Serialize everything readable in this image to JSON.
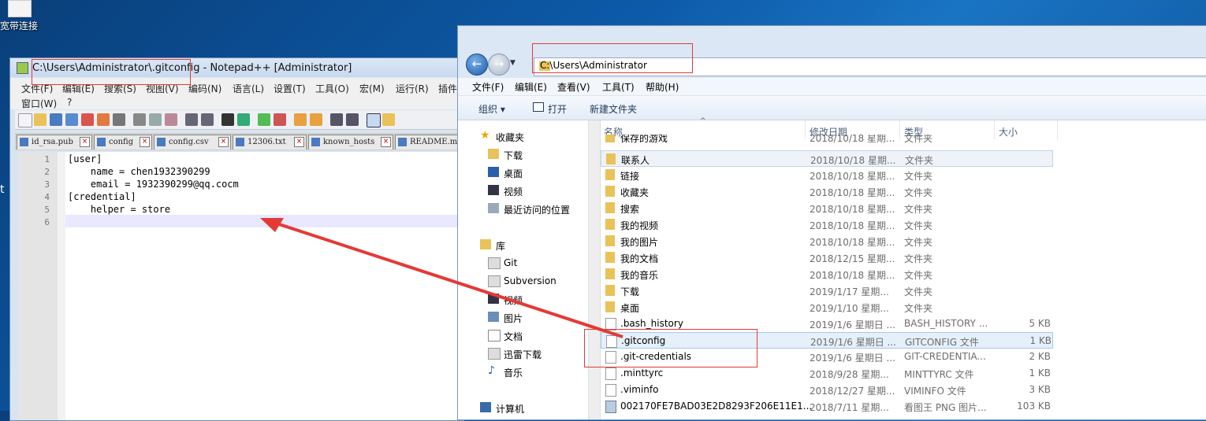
{
  "desktop": {
    "icon_label": "宽带连接",
    "fragment": "t"
  },
  "notepad": {
    "title": "C:\\Users\\Administrator\\.gitconfig - Notepad++ [Administrator]",
    "menu": [
      "文件(F)",
      "编辑(E)",
      "搜索(S)",
      "视图(V)",
      "编码(N)",
      "语言(L)",
      "设置(T)",
      "工具(O)",
      "宏(M)",
      "运行(R)",
      "插件",
      "窗口(W)",
      "?"
    ],
    "tabs": [
      "id_rsa.pub",
      "config",
      "config.csv",
      "12306.txt",
      "known_hosts",
      "README.md"
    ],
    "lines": [
      "1",
      "2",
      "3",
      "4",
      "5",
      "6"
    ],
    "code": [
      "[user]",
      "    name = chen1932390299",
      "    email = 1932390299@qq.cocm",
      "[credential]",
      "    helper = store",
      ""
    ]
  },
  "explorer": {
    "address": "C:\\Users\\Administrator",
    "menu": [
      "文件(F)",
      "编辑(E)",
      "查看(V)",
      "工具(T)",
      "帮助(H)"
    ],
    "commands": {
      "organize": "组织 ▾",
      "open": "打开",
      "new_folder": "新建文件夹"
    },
    "sidebar": {
      "favorites": "收藏夹",
      "fav_items": [
        "下载",
        "桌面",
        "视频",
        "最近访问的位置"
      ],
      "libraries": "库",
      "lib_items": [
        "Git",
        "Subversion",
        "视频",
        "图片",
        "文档",
        "迅雷下载",
        "音乐"
      ],
      "computer": "计算机"
    },
    "columns": {
      "name": "名称",
      "date": "修改日期",
      "type": "类型",
      "size": "大小"
    },
    "files": [
      {
        "name": "保存的游戏",
        "date": "2018/10/18 星期...",
        "type": "文件夹",
        "size": ""
      },
      {
        "name": "联系人",
        "date": "2018/10/18 星期...",
        "type": "文件夹",
        "size": ""
      },
      {
        "name": "链接",
        "date": "2018/10/18 星期...",
        "type": "文件夹",
        "size": ""
      },
      {
        "name": "收藏夹",
        "date": "2018/10/18 星期...",
        "type": "文件夹",
        "size": ""
      },
      {
        "name": "搜索",
        "date": "2018/10/18 星期...",
        "type": "文件夹",
        "size": ""
      },
      {
        "name": "我的视频",
        "date": "2018/10/18 星期...",
        "type": "文件夹",
        "size": ""
      },
      {
        "name": "我的图片",
        "date": "2018/10/18 星期...",
        "type": "文件夹",
        "size": ""
      },
      {
        "name": "我的文档",
        "date": "2018/12/15 星期...",
        "type": "文件夹",
        "size": ""
      },
      {
        "name": "我的音乐",
        "date": "2018/10/18 星期...",
        "type": "文件夹",
        "size": ""
      },
      {
        "name": "下载",
        "date": "2019/1/17 星期...",
        "type": "文件夹",
        "size": ""
      },
      {
        "name": "桌面",
        "date": "2019/1/10 星期...",
        "type": "文件夹",
        "size": ""
      },
      {
        "name": ".bash_history",
        "date": "2019/1/6 星期日 ...",
        "type": "BASH_HISTORY ...",
        "size": "5 KB"
      },
      {
        "name": ".gitconfig",
        "date": "2019/1/6 星期日 ...",
        "type": "GITCONFIG 文件",
        "size": "1 KB"
      },
      {
        "name": ".git-credentials",
        "date": "2019/1/6 星期日 ...",
        "type": "GIT-CREDENTIA...",
        "size": "2 KB"
      },
      {
        "name": ".minttyrc",
        "date": "2018/9/28 星期...",
        "type": "MINTTYRC 文件",
        "size": "1 KB"
      },
      {
        "name": ".viminfo",
        "date": "2018/12/27 星期...",
        "type": "VIMINFO 文件",
        "size": "3 KB"
      },
      {
        "name": "002170FE7BAD03E2D8293F206E11E1...",
        "date": "2018/7/11 星期...",
        "type": "看图王 PNG 图片...",
        "size": "103 KB"
      }
    ]
  },
  "colors": {
    "annotation": "#e53935",
    "folder": "#e9c25a"
  }
}
